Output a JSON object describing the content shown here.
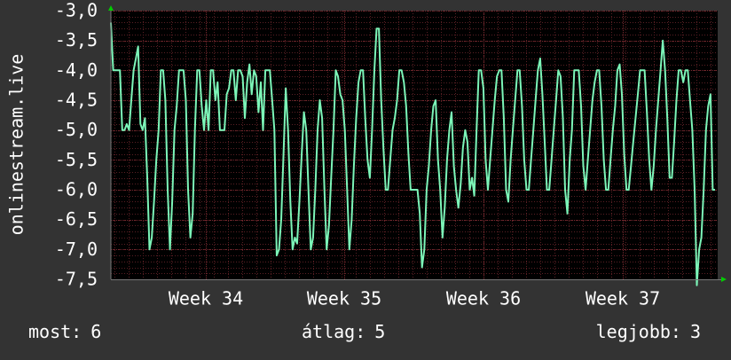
{
  "chart_data": {
    "type": "line",
    "ylabel": "onlinestream.live",
    "ylim": [
      -7.5,
      -3.0
    ],
    "y_ticks": [
      "-3,0",
      "-3,5",
      "-4,0",
      "-4,5",
      "-5,0",
      "-5,5",
      "-6,0",
      "-6,5",
      "-7,0",
      "-7,5"
    ],
    "x_ticks": [
      "Week 34",
      "Week 35",
      "Week 36",
      "Week 37"
    ],
    "grid": true,
    "colors": {
      "background": "#333333",
      "plot_bg": "#000000",
      "line": "#7cf5b8",
      "grid": "#5a1f24",
      "axis_arrow": "#00cc00",
      "text": "#ffffff"
    },
    "series": [
      {
        "values": [
          -3.2,
          -4.0,
          -4.0,
          -4.0,
          -4.0,
          -5.0,
          -5.0,
          -4.9,
          -5.0,
          -4.5,
          -4.0,
          -3.8,
          -3.6,
          -4.9,
          -5.0,
          -4.8,
          -5.8,
          -7.0,
          -6.8,
          -6.2,
          -5.5,
          -5.0,
          -4.0,
          -4.0,
          -4.5,
          -6.0,
          -7.0,
          -6.2,
          -5.0,
          -4.6,
          -4.0,
          -4.0,
          -4.0,
          -4.5,
          -6.0,
          -6.8,
          -6.4,
          -5.0,
          -4.0,
          -4.0,
          -4.6,
          -5.0,
          -4.5,
          -5.0,
          -4.0,
          -4.0,
          -4.5,
          -4.2,
          -5.0,
          -5.0,
          -5.0,
          -4.4,
          -4.3,
          -4.0,
          -4.0,
          -4.5,
          -4.0,
          -4.0,
          -4.1,
          -4.8,
          -4.2,
          -3.9,
          -4.4,
          -4.0,
          -4.1,
          -4.7,
          -4.2,
          -5.0,
          -4.0,
          -4.0,
          -4.0,
          -4.5,
          -5.0,
          -7.1,
          -7.0,
          -6.5,
          -5.4,
          -4.3,
          -5.0,
          -6.2,
          -7.0,
          -6.8,
          -6.9,
          -6.2,
          -5.4,
          -4.7,
          -5.0,
          -6.0,
          -7.0,
          -6.8,
          -6.0,
          -5.0,
          -4.5,
          -4.8,
          -6.0,
          -7.0,
          -6.6,
          -5.8,
          -5.0,
          -4.0,
          -4.1,
          -4.4,
          -4.5,
          -5.0,
          -6.0,
          -7.0,
          -6.5,
          -5.6,
          -4.8,
          -4.2,
          -4.0,
          -4.0,
          -4.8,
          -5.5,
          -5.8,
          -5.0,
          -4.0,
          -3.3,
          -3.3,
          -4.5,
          -5.3,
          -6.0,
          -6.0,
          -5.5,
          -5.0,
          -4.8,
          -4.5,
          -4.0,
          -4.0,
          -4.2,
          -4.6,
          -5.4,
          -6.0,
          -6.0,
          -6.0,
          -6.0,
          -6.4,
          -7.3,
          -7.0,
          -6.0,
          -5.6,
          -5.0,
          -4.6,
          -4.5,
          -5.5,
          -6.0,
          -6.8,
          -6.3,
          -5.5,
          -5.0,
          -4.7,
          -5.6,
          -6.0,
          -6.3,
          -5.9,
          -5.3,
          -5.0,
          -5.2,
          -6.0,
          -5.8,
          -6.1,
          -5.0,
          -4.0,
          -4.0,
          -4.3,
          -5.5,
          -6.0,
          -5.5,
          -5.0,
          -4.5,
          -4.1,
          -4.0,
          -4.0,
          -4.8,
          -6.0,
          -6.2,
          -5.5,
          -5.0,
          -4.5,
          -4.0,
          -4.0,
          -4.6,
          -5.5,
          -6.0,
          -6.0,
          -5.5,
          -5.0,
          -4.5,
          -4.0,
          -3.8,
          -4.4,
          -5.2,
          -6.0,
          -6.0,
          -5.5,
          -5.0,
          -4.5,
          -4.0,
          -4.1,
          -4.8,
          -6.0,
          -6.4,
          -5.5,
          -5.0,
          -4.0,
          -4.0,
          -4.0,
          -4.6,
          -5.6,
          -6.0,
          -5.5,
          -5.0,
          -4.5,
          -4.2,
          -4.0,
          -4.0,
          -4.6,
          -5.5,
          -6.0,
          -6.0,
          -5.5,
          -5.0,
          -4.6,
          -4.0,
          -3.9,
          -4.4,
          -5.4,
          -6.0,
          -6.0,
          -5.6,
          -5.2,
          -4.8,
          -4.4,
          -4.0,
          -4.0,
          -4.0,
          -4.7,
          -5.5,
          -6.0,
          -5.6,
          -5.0,
          -4.5,
          -4.0,
          -3.5,
          -4.0,
          -4.8,
          -5.8,
          -5.8,
          -5.2,
          -4.5,
          -4.0,
          -4.0,
          -4.2,
          -4.0,
          -4.0,
          -4.5,
          -5.0,
          -6.0,
          -7.6,
          -7.0,
          -6.8,
          -6.0,
          -5.0,
          -4.6,
          -4.4,
          -6.0,
          -6.0
        ]
      }
    ]
  },
  "footer": {
    "most_label": "most:",
    "most_value": "6",
    "avg_label": "átlag:",
    "avg_value": "5",
    "best_label": "legjobb:",
    "best_value": "3"
  }
}
